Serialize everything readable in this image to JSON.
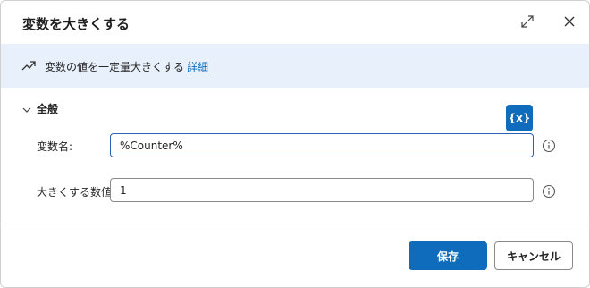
{
  "dialog": {
    "title": "変数を大きくする",
    "description": "変数の値を一定量大きくする",
    "details_link": "詳細",
    "section_label": "全般",
    "variable_button": "{x}",
    "fields": {
      "variable_name_label": "変数名:",
      "variable_name_value": "%Counter%",
      "increase_by_label": "大きくする数値:",
      "increase_by_value": "1"
    },
    "buttons": {
      "save": "保存",
      "cancel": "キャンセル"
    },
    "colors": {
      "accent": "#0f6cbd",
      "banner_background": "#e8f1fb"
    }
  }
}
